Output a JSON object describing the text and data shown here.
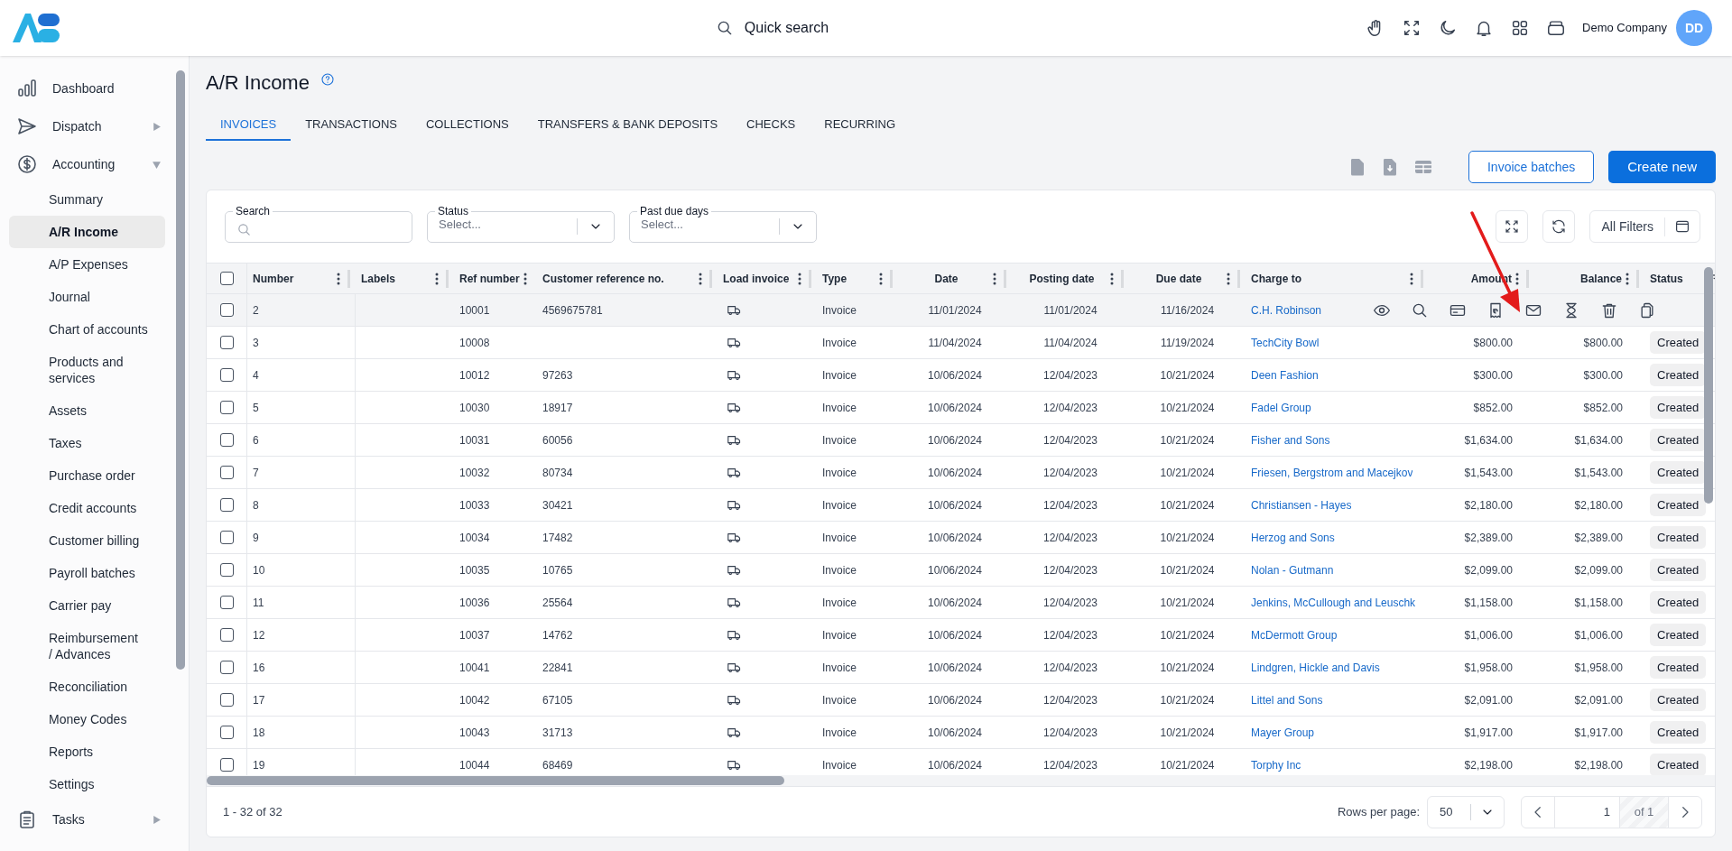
{
  "header": {
    "search_label": "Quick search",
    "company": "Demo Company",
    "avatar": "DD"
  },
  "sidebar": {
    "items": [
      {
        "label": "Dashboard"
      },
      {
        "label": "Dispatch",
        "expanded": false
      },
      {
        "label": "Accounting",
        "expanded": true,
        "children": [
          {
            "label": "Summary",
            "selected": false
          },
          {
            "label": "A/R Income",
            "selected": true
          },
          {
            "label": "A/P Expenses",
            "selected": false
          },
          {
            "label": "Journal",
            "selected": false
          },
          {
            "label": "Chart of accounts",
            "selected": false
          },
          {
            "label": "Products and services",
            "selected": false
          },
          {
            "label": "Assets",
            "selected": false
          },
          {
            "label": "Taxes",
            "selected": false
          },
          {
            "label": "Purchase order",
            "selected": false
          },
          {
            "label": "Credit accounts",
            "selected": false
          },
          {
            "label": "Customer billing",
            "selected": false
          },
          {
            "label": "Payroll batches",
            "selected": false
          },
          {
            "label": "Carrier pay",
            "selected": false
          },
          {
            "label": "Reimbursement / Advances",
            "selected": false
          },
          {
            "label": "Reconciliation",
            "selected": false
          },
          {
            "label": "Money Codes",
            "selected": false
          },
          {
            "label": "Reports",
            "selected": false
          },
          {
            "label": "Settings",
            "selected": false
          }
        ]
      },
      {
        "label": "Tasks",
        "expanded": false
      }
    ]
  },
  "page": {
    "title": "A/R Income"
  },
  "tabs": [
    {
      "label": "INVOICES",
      "selected": true
    },
    {
      "label": "TRANSACTIONS",
      "selected": false
    },
    {
      "label": "COLLECTIONS",
      "selected": false
    },
    {
      "label": "TRANSFERS & BANK DEPOSITS",
      "selected": false
    },
    {
      "label": "CHECKS",
      "selected": false
    },
    {
      "label": "RECURRING",
      "selected": false
    }
  ],
  "buttons": {
    "secondary": "Invoice batches",
    "primary": "Create new"
  },
  "filters": [
    {
      "label": "Search",
      "kind": "search"
    },
    {
      "label": "Status",
      "kind": "select",
      "placeholder": "Select..."
    },
    {
      "label": "Past due days",
      "kind": "select",
      "placeholder": "Select..."
    }
  ],
  "all_filters": "All Filters",
  "table": {
    "all_selected": false,
    "columns": [
      "Number",
      "Labels",
      "Ref number",
      "Customer reference no.",
      "Load invoice",
      "Type",
      "Date",
      "Posting date",
      "Due date",
      "Charge to",
      "Amount",
      "Balance",
      "Status"
    ],
    "rows": [
      {
        "number": "2",
        "ref": "10001",
        "cust_ref": "4569675781",
        "type": "Invoice",
        "date": "11/01/2024",
        "posting": "11/01/2024",
        "due": "11/16/2024",
        "charge_to": "C.H. Robinson",
        "checked": false,
        "hovered": true
      },
      {
        "number": "3",
        "ref": "10008",
        "type": "Invoice",
        "date": "11/04/2024",
        "posting": "11/04/2024",
        "due": "11/19/2024",
        "charge_to": "TechCity Bowl",
        "amount": "$800.00",
        "balance": "$800.00",
        "status": "Created",
        "checked": false,
        "hovered": false
      },
      {
        "number": "4",
        "ref": "10012",
        "cust_ref": "97263",
        "type": "Invoice",
        "date": "10/06/2024",
        "posting": "12/04/2023",
        "due": "10/21/2024",
        "charge_to": "Deen Fashion",
        "amount": "$300.00",
        "balance": "$300.00",
        "status": "Created",
        "checked": false,
        "hovered": false
      },
      {
        "number": "5",
        "ref": "10030",
        "cust_ref": "18917",
        "type": "Invoice",
        "date": "10/06/2024",
        "posting": "12/04/2023",
        "due": "10/21/2024",
        "charge_to": "Fadel Group",
        "amount": "$852.00",
        "balance": "$852.00",
        "status": "Created",
        "checked": false,
        "hovered": false
      },
      {
        "number": "6",
        "ref": "10031",
        "cust_ref": "60056",
        "type": "Invoice",
        "date": "10/06/2024",
        "posting": "12/04/2023",
        "due": "10/21/2024",
        "charge_to": "Fisher and Sons",
        "amount": "$1,634.00",
        "balance": "$1,634.00",
        "status": "Created",
        "checked": false,
        "hovered": false
      },
      {
        "number": "7",
        "ref": "10032",
        "cust_ref": "80734",
        "type": "Invoice",
        "date": "10/06/2024",
        "posting": "12/04/2023",
        "due": "10/21/2024",
        "charge_to": "Friesen, Bergstrom and Macejkov",
        "amount": "$1,543.00",
        "balance": "$1,543.00",
        "status": "Created",
        "checked": false,
        "hovered": false
      },
      {
        "number": "8",
        "ref": "10033",
        "cust_ref": "30421",
        "type": "Invoice",
        "date": "10/06/2024",
        "posting": "12/04/2023",
        "due": "10/21/2024",
        "charge_to": "Christiansen - Hayes",
        "amount": "$2,180.00",
        "balance": "$2,180.00",
        "status": "Created",
        "checked": false,
        "hovered": false
      },
      {
        "number": "9",
        "ref": "10034",
        "cust_ref": "17482",
        "type": "Invoice",
        "date": "10/06/2024",
        "posting": "12/04/2023",
        "due": "10/21/2024",
        "charge_to": "Herzog and Sons",
        "amount": "$2,389.00",
        "balance": "$2,389.00",
        "status": "Created",
        "checked": false,
        "hovered": false
      },
      {
        "number": "10",
        "ref": "10035",
        "cust_ref": "10765",
        "type": "Invoice",
        "date": "10/06/2024",
        "posting": "12/04/2023",
        "due": "10/21/2024",
        "charge_to": "Nolan - Gutmann",
        "amount": "$2,099.00",
        "balance": "$2,099.00",
        "status": "Created",
        "checked": false,
        "hovered": false
      },
      {
        "number": "11",
        "ref": "10036",
        "cust_ref": "25564",
        "type": "Invoice",
        "date": "10/06/2024",
        "posting": "12/04/2023",
        "due": "10/21/2024",
        "charge_to": "Jenkins, McCullough and Leuschk",
        "amount": "$1,158.00",
        "balance": "$1,158.00",
        "status": "Created",
        "checked": false,
        "hovered": false
      },
      {
        "number": "12",
        "ref": "10037",
        "cust_ref": "14762",
        "type": "Invoice",
        "date": "10/06/2024",
        "posting": "12/04/2023",
        "due": "10/21/2024",
        "charge_to": "McDermott Group",
        "amount": "$1,006.00",
        "balance": "$1,006.00",
        "status": "Created",
        "checked": false,
        "hovered": false
      },
      {
        "number": "16",
        "ref": "10041",
        "cust_ref": "22841",
        "type": "Invoice",
        "date": "10/06/2024",
        "posting": "12/04/2023",
        "due": "10/21/2024",
        "charge_to": "Lindgren, Hickle and Davis",
        "amount": "$1,958.00",
        "balance": "$1,958.00",
        "status": "Created",
        "checked": false,
        "hovered": false
      },
      {
        "number": "17",
        "ref": "10042",
        "cust_ref": "67105",
        "type": "Invoice",
        "date": "10/06/2024",
        "posting": "12/04/2023",
        "due": "10/21/2024",
        "charge_to": "Littel and Sons",
        "amount": "$2,091.00",
        "balance": "$2,091.00",
        "status": "Created",
        "checked": false,
        "hovered": false
      },
      {
        "number": "18",
        "ref": "10043",
        "cust_ref": "31713",
        "type": "Invoice",
        "date": "10/06/2024",
        "posting": "12/04/2023",
        "due": "10/21/2024",
        "charge_to": "Mayer Group",
        "amount": "$1,917.00",
        "balance": "$1,917.00",
        "status": "Created",
        "checked": false,
        "hovered": false
      },
      {
        "number": "19",
        "ref": "10044",
        "cust_ref": "68469",
        "type": "Invoice",
        "date": "10/06/2024",
        "posting": "12/04/2023",
        "due": "10/21/2024",
        "charge_to": "Torphy Inc",
        "amount": "$2,198.00",
        "balance": "$2,198.00",
        "status": "Created",
        "checked": false,
        "hovered": false
      }
    ]
  },
  "footer": {
    "range": "1 - 32 of 32",
    "rows_per_page_label": "Rows per page:",
    "rows_per_page": "50",
    "page": "1",
    "of": "of 1"
  }
}
